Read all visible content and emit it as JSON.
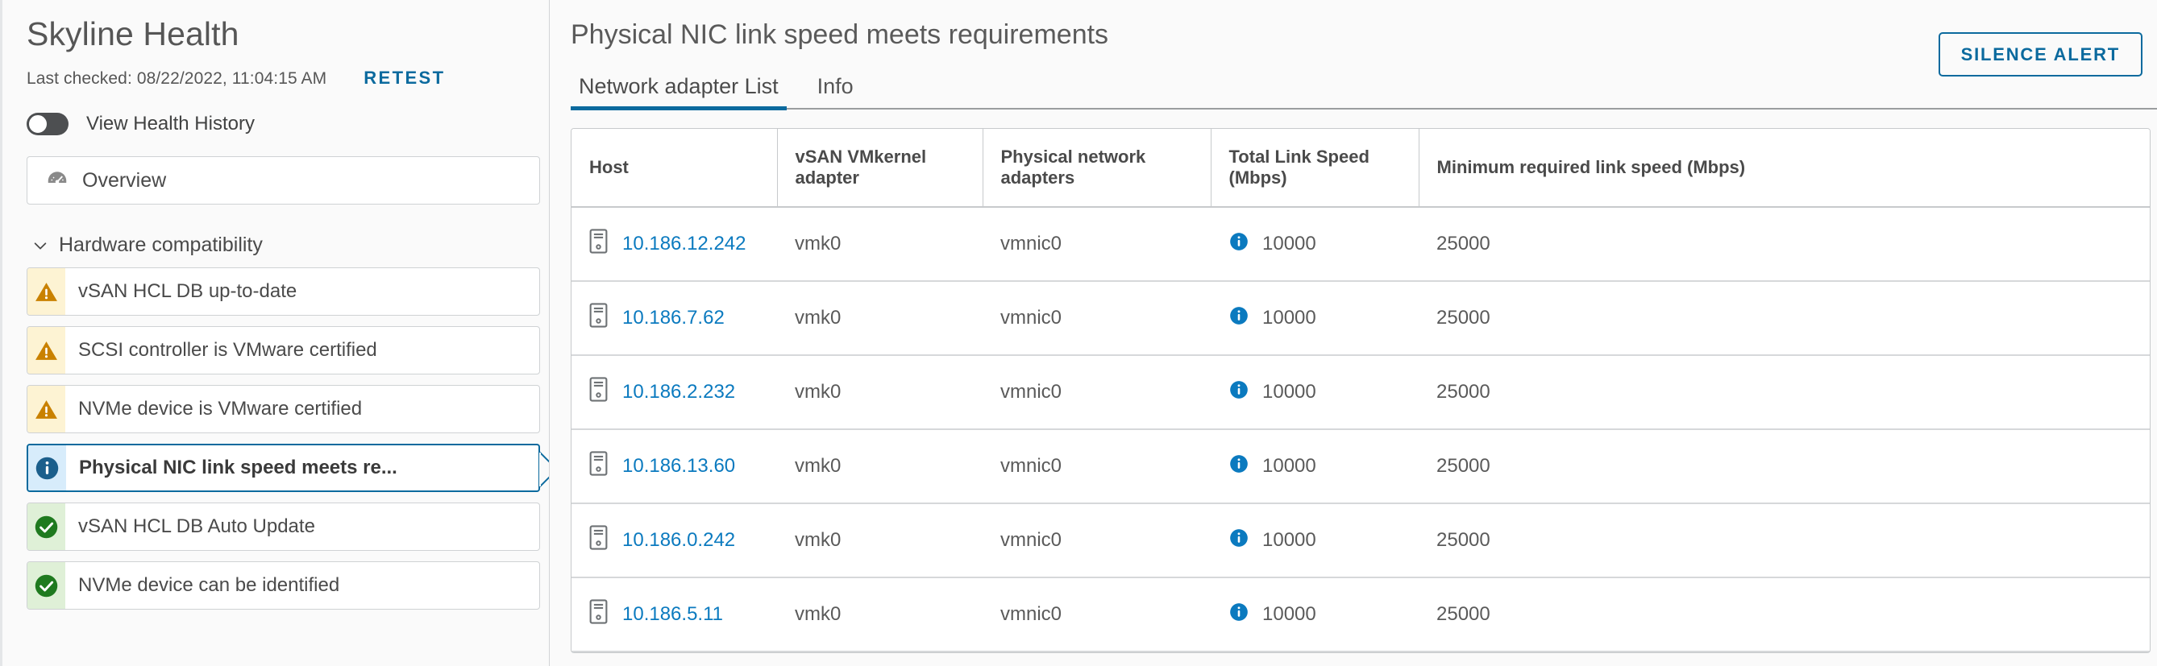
{
  "sidebar": {
    "app_title": "Skyline Health",
    "last_checked": "Last checked: 08/22/2022, 11:04:15 AM",
    "retest_label": "RETEST",
    "history_toggle_label": "View Health History",
    "history_toggle_state": "off",
    "overview": {
      "label": "Overview",
      "icon": "gauge-icon"
    },
    "group": {
      "label": "Hardware compatibility",
      "expanded": true,
      "icon": "chevron-down-icon"
    },
    "checks": [
      {
        "label": "vSAN HCL DB up-to-date",
        "status": "warning",
        "icon": "warning-triangle-icon",
        "selected": false
      },
      {
        "label": "SCSI controller is VMware certified",
        "status": "warning",
        "icon": "warning-triangle-icon",
        "selected": false
      },
      {
        "label": "NVMe device is VMware certified",
        "status": "warning",
        "icon": "warning-triangle-icon",
        "selected": false
      },
      {
        "label": "Physical NIC link speed meets re...",
        "status": "info",
        "icon": "info-circle-icon",
        "selected": true
      },
      {
        "label": "vSAN HCL DB Auto Update",
        "status": "ok",
        "icon": "check-circle-icon",
        "selected": false
      },
      {
        "label": "NVMe device can be identified",
        "status": "ok",
        "icon": "check-circle-icon",
        "selected": false
      }
    ]
  },
  "main": {
    "page_title": "Physical NIC link speed meets requirements",
    "silence_button": "SILENCE ALERT",
    "tabs": [
      {
        "label": "Network adapter List",
        "active": true
      },
      {
        "label": "Info",
        "active": false
      }
    ],
    "table": {
      "columns": [
        "Host",
        "vSAN VMkernel adapter",
        "Physical network adapters",
        "Total Link Speed (Mbps)",
        "Minimum required link speed (Mbps)"
      ],
      "rows": [
        {
          "host": "10.186.12.242",
          "vmkernel": "vmk0",
          "pnic": "vmnic0",
          "total_speed": "10000",
          "min_speed": "25000",
          "speed_icon": "info-circle-icon"
        },
        {
          "host": "10.186.7.62",
          "vmkernel": "vmk0",
          "pnic": "vmnic0",
          "total_speed": "10000",
          "min_speed": "25000",
          "speed_icon": "info-circle-icon"
        },
        {
          "host": "10.186.2.232",
          "vmkernel": "vmk0",
          "pnic": "vmnic0",
          "total_speed": "10000",
          "min_speed": "25000",
          "speed_icon": "info-circle-icon"
        },
        {
          "host": "10.186.13.60",
          "vmkernel": "vmk0",
          "pnic": "vmnic0",
          "total_speed": "10000",
          "min_speed": "25000",
          "speed_icon": "info-circle-icon"
        },
        {
          "host": "10.186.0.242",
          "vmkernel": "vmk0",
          "pnic": "vmnic0",
          "total_speed": "10000",
          "min_speed": "25000",
          "speed_icon": "info-circle-icon"
        },
        {
          "host": "10.186.5.11",
          "vmkernel": "vmk0",
          "pnic": "vmnic0",
          "total_speed": "10000",
          "min_speed": "25000",
          "speed_icon": "info-circle-icon"
        }
      ]
    }
  },
  "colors": {
    "accent_blue": "#0b6a9e",
    "link_blue": "#0b7abf",
    "warning_amber": "#c98100",
    "warning_bg": "#fdf3d3",
    "success_green": "#1f7a1f",
    "success_bg": "#dff0d7",
    "info_blue": "#1b5f8c",
    "info_bg": "#d7ecfb",
    "text_gray": "#4a4a4a",
    "page_bg": "#fafafa"
  }
}
